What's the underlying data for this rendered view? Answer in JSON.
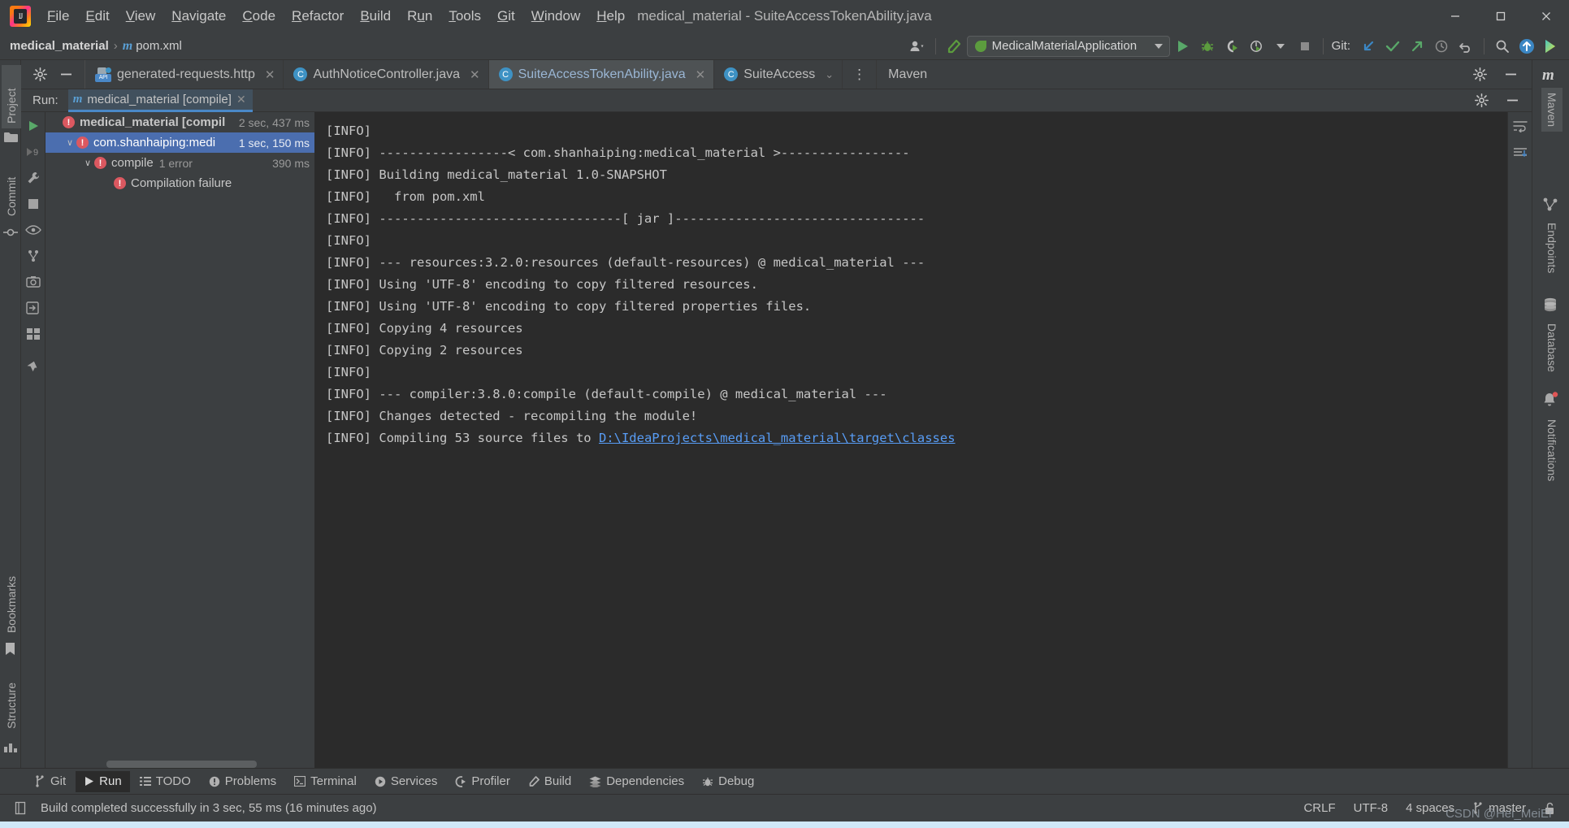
{
  "window": {
    "title": "medical_material - SuiteAccessTokenAbility.java",
    "minimize_label": "—",
    "maximize_label": "❐",
    "close_label": "✕"
  },
  "menubar": {
    "items": [
      {
        "label": "File",
        "mnemonic": "F"
      },
      {
        "label": "Edit",
        "mnemonic": "E"
      },
      {
        "label": "View",
        "mnemonic": "V"
      },
      {
        "label": "Navigate",
        "mnemonic": "N"
      },
      {
        "label": "Code",
        "mnemonic": "C"
      },
      {
        "label": "Refactor",
        "mnemonic": "R"
      },
      {
        "label": "Build",
        "mnemonic": "B"
      },
      {
        "label": "Run",
        "mnemonic": "u"
      },
      {
        "label": "Tools",
        "mnemonic": "T"
      },
      {
        "label": "Git",
        "mnemonic": "G"
      },
      {
        "label": "Window",
        "mnemonic": "W"
      },
      {
        "label": "Help",
        "mnemonic": "H"
      }
    ]
  },
  "navbar": {
    "breadcrumb": [
      "medical_material",
      "pom.xml"
    ],
    "separator": "›",
    "run_configuration": "MedicalMaterialApplication",
    "git_label": "Git:"
  },
  "editor_tabs": [
    {
      "label": "generated-requests.http",
      "icon": "http-api-icon",
      "active": false,
      "closable": true
    },
    {
      "label": "AuthNoticeController.java",
      "icon": "java-class-icon",
      "active": false,
      "closable": true
    },
    {
      "label": "SuiteAccessTokenAbility.java",
      "icon": "java-class-icon",
      "active": true,
      "closable": true
    },
    {
      "label": "SuiteAccess",
      "icon": "java-class-icon",
      "active": false,
      "closable": false
    }
  ],
  "maven_tab_label": "Maven",
  "run_panel": {
    "title": "Run:",
    "tab_label": "medical_material [compile]",
    "tree": [
      {
        "label": "medical_material [compil",
        "time": "2 sec, 437 ms",
        "status": "error",
        "bold": true,
        "indent": 0,
        "expander": "",
        "selected": false,
        "sub": ""
      },
      {
        "label": "com.shanhaiping:medi",
        "time": "1 sec, 150 ms",
        "status": "error",
        "bold": false,
        "indent": 1,
        "expander": "∨",
        "selected": true,
        "sub": ""
      },
      {
        "label": "compile",
        "time": "390 ms",
        "status": "error",
        "bold": false,
        "indent": 2,
        "expander": "∨",
        "selected": false,
        "sub": "1 error"
      },
      {
        "label": "Compilation failure",
        "time": "",
        "status": "error",
        "bold": false,
        "indent": 3,
        "expander": "",
        "selected": false,
        "sub": ""
      }
    ]
  },
  "console": {
    "lines": [
      {
        "text": "[INFO] "
      },
      {
        "text": "[INFO] -----------------< com.shanhaiping:medical_material >-----------------"
      },
      {
        "text": "[INFO] Building medical_material 1.0-SNAPSHOT"
      },
      {
        "text": "[INFO]   from pom.xml"
      },
      {
        "text": "[INFO] --------------------------------[ jar ]---------------------------------"
      },
      {
        "text": "[INFO] "
      },
      {
        "text": "[INFO] --- resources:3.2.0:resources (default-resources) @ medical_material ---"
      },
      {
        "text": "[INFO] Using 'UTF-8' encoding to copy filtered resources."
      },
      {
        "text": "[INFO] Using 'UTF-8' encoding to copy filtered properties files."
      },
      {
        "text": "[INFO] Copying 4 resources"
      },
      {
        "text": "[INFO] Copying 2 resources"
      },
      {
        "text": "[INFO] "
      },
      {
        "text": "[INFO] --- compiler:3.8.0:compile (default-compile) @ medical_material ---"
      },
      {
        "text": "[INFO] Changes detected - recompiling the module!"
      },
      {
        "text": "[INFO] Compiling 53 source files to ",
        "link": "D:\\IdeaProjects\\medical_material\\target\\classes"
      }
    ]
  },
  "left_stripe": [
    {
      "label": "Project",
      "icon": "folder-icon",
      "selected": true
    },
    {
      "label": "Commit",
      "icon": "commit-icon",
      "selected": false
    },
    {
      "label": "Bookmarks",
      "icon": "bookmark-icon",
      "selected": false
    },
    {
      "label": "Structure",
      "icon": "structure-icon",
      "selected": false
    }
  ],
  "right_stripe": [
    {
      "label": "Maven",
      "icon": "maven-icon",
      "selected": true
    },
    {
      "label": "Endpoints",
      "icon": "endpoints-icon",
      "selected": false
    },
    {
      "label": "Database",
      "icon": "database-icon",
      "selected": false
    },
    {
      "label": "Notifications",
      "icon": "notifications-icon",
      "selected": false,
      "badge": true
    }
  ],
  "tool_windows": [
    {
      "label": "Git",
      "icon": "git-branch-icon",
      "active": false
    },
    {
      "label": "Run",
      "icon": "run-icon",
      "active": true
    },
    {
      "label": "TODO",
      "icon": "todo-icon",
      "active": false
    },
    {
      "label": "Problems",
      "icon": "problems-icon",
      "active": false
    },
    {
      "label": "Terminal",
      "icon": "terminal-icon",
      "active": false
    },
    {
      "label": "Services",
      "icon": "services-icon",
      "active": false
    },
    {
      "label": "Profiler",
      "icon": "profiler-icon",
      "active": false
    },
    {
      "label": "Build",
      "icon": "build-hammer-icon",
      "active": false
    },
    {
      "label": "Dependencies",
      "icon": "dependencies-icon",
      "active": false
    },
    {
      "label": "Debug",
      "icon": "debug-bug-icon",
      "active": false
    }
  ],
  "statusbar": {
    "message": "Build completed successfully in 3 sec, 55 ms (16 minutes ago)",
    "line_separator": "CRLF",
    "encoding": "UTF-8",
    "indent": "4 spaces",
    "branch": "master"
  },
  "watermark": "CSDN @Hei_MeiEr",
  "colors": {
    "accent_blue": "#4a88c7",
    "selection_blue": "#4b6eaf",
    "error_red": "#db5860",
    "link_blue": "#589df6",
    "green_run": "#59a869",
    "console_bg": "#2b2b2b",
    "panel_bg": "#3c3f41"
  }
}
